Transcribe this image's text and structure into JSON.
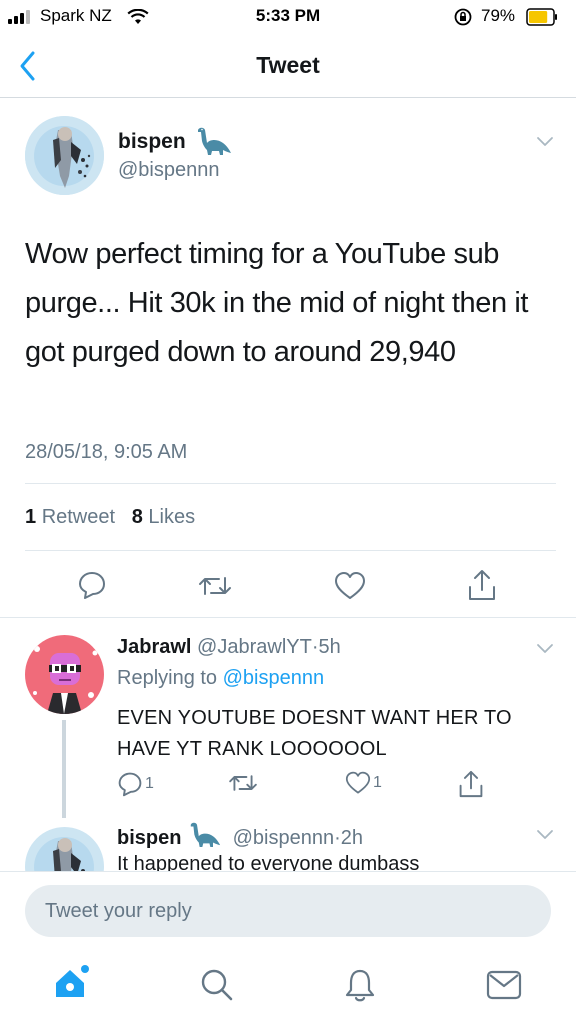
{
  "status_bar": {
    "carrier": "Spark NZ",
    "time": "5:33 PM",
    "battery_percent": "79%",
    "battery_level": 0.79,
    "icons": [
      "signal-icon",
      "wifi-icon",
      "orientation-lock-icon",
      "battery-icon"
    ]
  },
  "nav": {
    "title": "Tweet",
    "back_icon": "chevron-left-icon"
  },
  "tweet": {
    "name": "bispen",
    "handle": "@bispennn",
    "text": "Wow perfect timing for a YouTube sub purge... Hit 30k in the mid of night then it got purged down to around 29,940",
    "timestamp": "28/05/18, 9:05 AM",
    "retweets_count": "1",
    "retweets_label": "Retweet",
    "likes_count": "8",
    "likes_label": "Likes",
    "actions": [
      "reply-icon",
      "retweet-icon",
      "like-icon",
      "share-icon"
    ]
  },
  "replies": [
    {
      "name": "Jabrawl",
      "handle": "@JabrawlYT",
      "dot": "·",
      "time": "5h",
      "replying_prefix": "Replying to",
      "replying_to": "@bispennn",
      "text": "EVEN YOUTUBE DOESNT WANT HER TO HAVE YT RANK LOOOOOOL",
      "reply_count": "1",
      "like_count": "1"
    },
    {
      "name": "bispen",
      "handle": "@bispennn",
      "dot": "·",
      "time": "2h",
      "text": "It happened to everyone dumbass"
    }
  ],
  "reply_box": {
    "placeholder": "Tweet your reply"
  },
  "tab_bar": {
    "items": [
      "home-icon",
      "search-icon",
      "notifications-icon",
      "messages-icon"
    ]
  },
  "colors": {
    "accent": "#1da1f2",
    "secondary_text": "#657786",
    "battery": "#f6c600"
  }
}
